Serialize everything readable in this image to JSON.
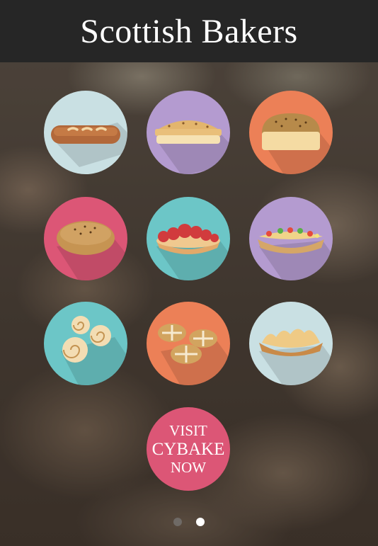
{
  "header": {
    "title": "Scottish Bakers"
  },
  "tiles": [
    {
      "name": "baguette",
      "icon": "baguette-icon",
      "color": "#c9e0e3"
    },
    {
      "name": "pie",
      "icon": "pie-icon",
      "color": "#b49bd0"
    },
    {
      "name": "loaf",
      "icon": "loaf-icon",
      "color": "#ec8057"
    },
    {
      "name": "bread-roll",
      "icon": "bread-roll-icon",
      "color": "#dc5676"
    },
    {
      "name": "strawberry-tart",
      "icon": "strawberry-tart-icon",
      "color": "#6cc6c7"
    },
    {
      "name": "filled-roll",
      "icon": "filled-roll-icon",
      "color": "#b49bd0"
    },
    {
      "name": "cinnamon-swirls",
      "icon": "cinnamon-swirls-icon",
      "color": "#6cc6c7"
    },
    {
      "name": "hot-cross-buns",
      "icon": "hot-cross-buns-icon",
      "color": "#ec8057"
    },
    {
      "name": "sausage-roll",
      "icon": "sausage-roll-icon",
      "color": "#c9e0e3"
    }
  ],
  "cta": {
    "line1": "VISIT",
    "line2": "CYBAKE",
    "line3": "NOW",
    "color": "#dc5676"
  },
  "pagination": {
    "count": 2,
    "active": 2
  }
}
